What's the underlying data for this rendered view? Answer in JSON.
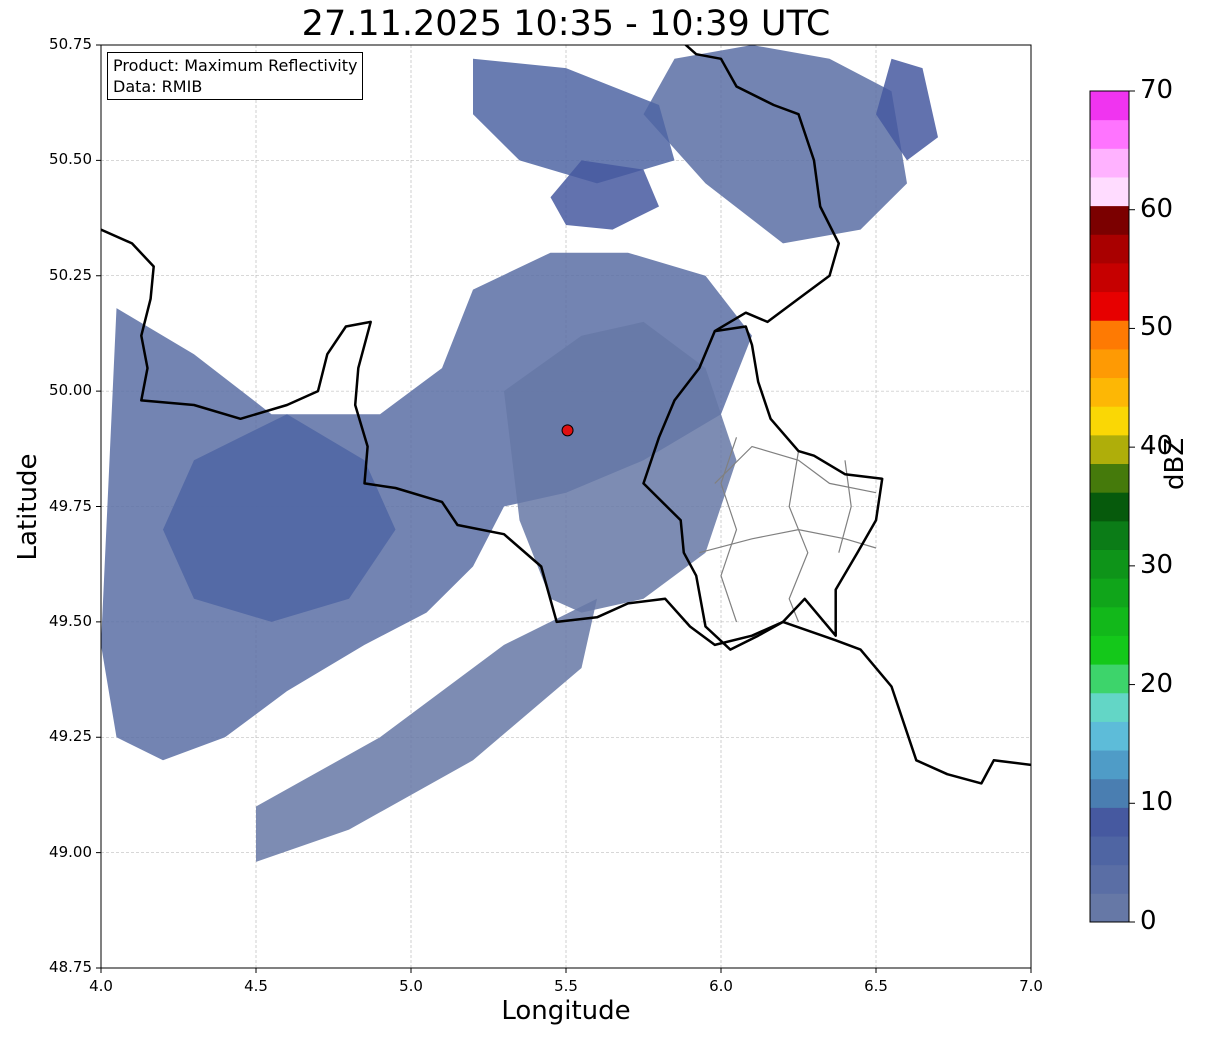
{
  "title": "27.11.2025 10:35 - 10:39 UTC",
  "info_box": {
    "product_line": "Product: Maximum Reflectivity",
    "data_line": "Data: RMIB"
  },
  "colors": {
    "frame": "#000000",
    "grid": "#b0b0b0",
    "border_line": "#000000",
    "region_line": "#808080",
    "radar_site_fill": "#e01010"
  },
  "chart_data": {
    "type": "heatmap",
    "xlabel": "Longitude",
    "ylabel": "Latitude",
    "xlim": [
      4.0,
      7.0
    ],
    "ylim": [
      48.75,
      50.75
    ],
    "xticks": [
      "4.0",
      "4.5",
      "5.0",
      "5.5",
      "6.0",
      "6.5",
      "7.0"
    ],
    "yticks": [
      "48.75",
      "49.00",
      "49.25",
      "49.50",
      "49.75",
      "50.00",
      "50.25",
      "50.50",
      "50.75"
    ],
    "grid": true,
    "radar_site": {
      "lon": 5.505,
      "lat": 49.915
    },
    "colorbar": {
      "label": "dBZ",
      "min": 0,
      "max": 70,
      "ticks": [
        "0",
        "10",
        "20",
        "30",
        "40",
        "50",
        "60",
        "70"
      ],
      "colors": [
        "#6678a6",
        "#5a6ea5",
        "#4f65a3",
        "#4659a0",
        "#4a7eb1",
        "#4f9cc7",
        "#5dbcd9",
        "#63d6c6",
        "#3dd46b",
        "#14c81a",
        "#12b81a",
        "#10a51a",
        "#0e9419",
        "#0b7c17",
        "#065a0c",
        "#457a0b",
        "#afae0a",
        "#fad705",
        "#fdb705",
        "#fe9a04",
        "#fe7a03",
        "#e70000",
        "#c60000",
        "#a90000",
        "#7b0000",
        "#ffdcff",
        "#ffb2ff",
        "#ff74ff",
        "#f034f0"
      ]
    },
    "echo_regions": [
      {
        "polygon": [
          [
            4.05,
            50.18
          ],
          [
            4.3,
            50.08
          ],
          [
            4.55,
            49.95
          ],
          [
            4.9,
            49.95
          ],
          [
            5.1,
            50.05
          ],
          [
            5.2,
            50.22
          ],
          [
            5.45,
            50.3
          ],
          [
            5.7,
            50.3
          ],
          [
            5.95,
            50.25
          ],
          [
            6.1,
            50.12
          ],
          [
            6.0,
            49.95
          ],
          [
            5.75,
            49.85
          ],
          [
            5.5,
            49.78
          ],
          [
            5.3,
            49.75
          ],
          [
            5.2,
            49.62
          ],
          [
            5.05,
            49.52
          ],
          [
            4.85,
            49.45
          ],
          [
            4.6,
            49.35
          ],
          [
            4.4,
            49.25
          ],
          [
            4.2,
            49.2
          ],
          [
            4.05,
            49.25
          ],
          [
            4.0,
            49.45
          ]
        ],
        "value": 3
      },
      {
        "polygon": [
          [
            5.3,
            50.0
          ],
          [
            5.55,
            50.12
          ],
          [
            5.75,
            50.15
          ],
          [
            5.95,
            50.05
          ],
          [
            6.05,
            49.85
          ],
          [
            5.95,
            49.65
          ],
          [
            5.75,
            49.55
          ],
          [
            5.55,
            49.52
          ],
          [
            5.45,
            49.55
          ],
          [
            5.35,
            49.72
          ]
        ],
        "value": 2
      },
      {
        "polygon": [
          [
            5.75,
            50.6
          ],
          [
            5.95,
            50.45
          ],
          [
            6.2,
            50.32
          ],
          [
            6.45,
            50.35
          ],
          [
            6.6,
            50.45
          ],
          [
            6.55,
            50.65
          ],
          [
            6.35,
            50.72
          ],
          [
            6.1,
            50.75
          ],
          [
            5.85,
            50.72
          ]
        ],
        "value": 3
      },
      {
        "polygon": [
          [
            5.2,
            50.72
          ],
          [
            5.5,
            50.7
          ],
          [
            5.8,
            50.62
          ],
          [
            5.85,
            50.5
          ],
          [
            5.6,
            50.45
          ],
          [
            5.35,
            50.5
          ],
          [
            5.2,
            50.6
          ]
        ],
        "value": 5
      },
      {
        "polygon": [
          [
            4.3,
            49.85
          ],
          [
            4.6,
            49.95
          ],
          [
            4.85,
            49.85
          ],
          [
            4.95,
            49.7
          ],
          [
            4.8,
            49.55
          ],
          [
            4.55,
            49.5
          ],
          [
            4.3,
            49.55
          ],
          [
            4.2,
            49.7
          ]
        ],
        "value": 5
      },
      {
        "polygon": [
          [
            4.5,
            49.1
          ],
          [
            4.9,
            49.25
          ],
          [
            5.3,
            49.45
          ],
          [
            5.6,
            49.55
          ],
          [
            5.55,
            49.4
          ],
          [
            5.2,
            49.2
          ],
          [
            4.8,
            49.05
          ],
          [
            4.5,
            48.98
          ]
        ],
        "value": 2
      },
      {
        "polygon": [
          [
            5.45,
            50.42
          ],
          [
            5.55,
            50.5
          ],
          [
            5.75,
            50.48
          ],
          [
            5.8,
            50.4
          ],
          [
            5.65,
            50.35
          ],
          [
            5.5,
            50.36
          ]
        ],
        "value": 9
      },
      {
        "polygon": [
          [
            6.5,
            50.6
          ],
          [
            6.6,
            50.5
          ],
          [
            6.7,
            50.55
          ],
          [
            6.65,
            50.7
          ],
          [
            6.55,
            50.72
          ]
        ],
        "value": 9
      }
    ],
    "borders": [
      [
        [
          4.0,
          50.35
        ],
        [
          4.1,
          50.32
        ],
        [
          4.17,
          50.27
        ],
        [
          4.16,
          50.2
        ],
        [
          4.13,
          50.12
        ],
        [
          4.15,
          50.05
        ],
        [
          4.13,
          49.98
        ],
        [
          4.3,
          49.97
        ],
        [
          4.45,
          49.94
        ],
        [
          4.6,
          49.97
        ],
        [
          4.7,
          50.0
        ],
        [
          4.73,
          50.08
        ],
        [
          4.79,
          50.14
        ],
        [
          4.87,
          50.15
        ],
        [
          4.83,
          50.05
        ],
        [
          4.82,
          49.97
        ],
        [
          4.86,
          49.88
        ],
        [
          4.85,
          49.8
        ],
        [
          4.95,
          49.79
        ],
        [
          5.1,
          49.76
        ],
        [
          5.15,
          49.71
        ],
        [
          5.3,
          49.69
        ],
        [
          5.42,
          49.62
        ],
        [
          5.47,
          49.5
        ],
        [
          5.6,
          49.51
        ],
        [
          5.7,
          49.54
        ],
        [
          5.82,
          49.55
        ],
        [
          5.9,
          49.49
        ],
        [
          5.98,
          49.45
        ],
        [
          6.1,
          49.47
        ],
        [
          6.2,
          49.5
        ],
        [
          6.37,
          49.46
        ],
        [
          6.45,
          49.44
        ],
        [
          6.55,
          49.36
        ],
        [
          6.63,
          49.2
        ],
        [
          6.73,
          49.17
        ],
        [
          6.84,
          49.15
        ],
        [
          6.88,
          49.2
        ],
        [
          7.0,
          49.19
        ]
      ],
      [
        [
          5.87,
          50.76
        ],
        [
          5.92,
          50.73
        ],
        [
          6.0,
          50.72
        ],
        [
          6.05,
          50.66
        ],
        [
          6.17,
          50.62
        ],
        [
          6.25,
          50.6
        ],
        [
          6.3,
          50.5
        ],
        [
          6.32,
          50.4
        ],
        [
          6.38,
          50.32
        ],
        [
          6.35,
          50.25
        ],
        [
          6.25,
          50.2
        ],
        [
          6.15,
          50.15
        ],
        [
          6.08,
          50.17
        ],
        [
          5.98,
          50.13
        ],
        [
          5.93,
          50.05
        ],
        [
          5.85,
          49.98
        ],
        [
          5.8,
          49.9
        ],
        [
          5.75,
          49.8
        ],
        [
          5.87,
          49.72
        ],
        [
          5.88,
          49.65
        ],
        [
          5.92,
          49.6
        ],
        [
          5.95,
          49.49
        ],
        [
          6.03,
          49.44
        ],
        [
          6.12,
          49.47
        ],
        [
          6.2,
          49.5
        ],
        [
          6.27,
          49.55
        ],
        [
          6.37,
          49.47
        ],
        [
          6.37,
          49.57
        ],
        [
          6.44,
          49.65
        ],
        [
          6.5,
          49.72
        ],
        [
          6.52,
          49.81
        ],
        [
          6.4,
          49.82
        ],
        [
          6.3,
          49.86
        ],
        [
          6.25,
          49.87
        ],
        [
          6.16,
          49.94
        ],
        [
          6.12,
          50.02
        ],
        [
          6.1,
          50.1
        ],
        [
          6.08,
          50.14
        ],
        [
          5.98,
          50.13
        ]
      ]
    ],
    "regions": [
      [
        [
          5.98,
          49.8
        ],
        [
          6.1,
          49.88
        ],
        [
          6.25,
          49.85
        ],
        [
          6.35,
          49.8
        ],
        [
          6.5,
          49.78
        ]
      ],
      [
        [
          5.93,
          49.65
        ],
        [
          6.1,
          49.68
        ],
        [
          6.25,
          49.7
        ],
        [
          6.4,
          49.68
        ],
        [
          6.5,
          49.66
        ]
      ],
      [
        [
          6.05,
          49.9
        ],
        [
          6.0,
          49.8
        ],
        [
          6.05,
          49.7
        ],
        [
          6.0,
          49.6
        ],
        [
          6.05,
          49.5
        ]
      ],
      [
        [
          6.25,
          49.87
        ],
        [
          6.22,
          49.75
        ],
        [
          6.28,
          49.65
        ],
        [
          6.22,
          49.55
        ],
        [
          6.25,
          49.5
        ]
      ],
      [
        [
          6.4,
          49.85
        ],
        [
          6.42,
          49.75
        ],
        [
          6.38,
          49.65
        ]
      ]
    ]
  }
}
